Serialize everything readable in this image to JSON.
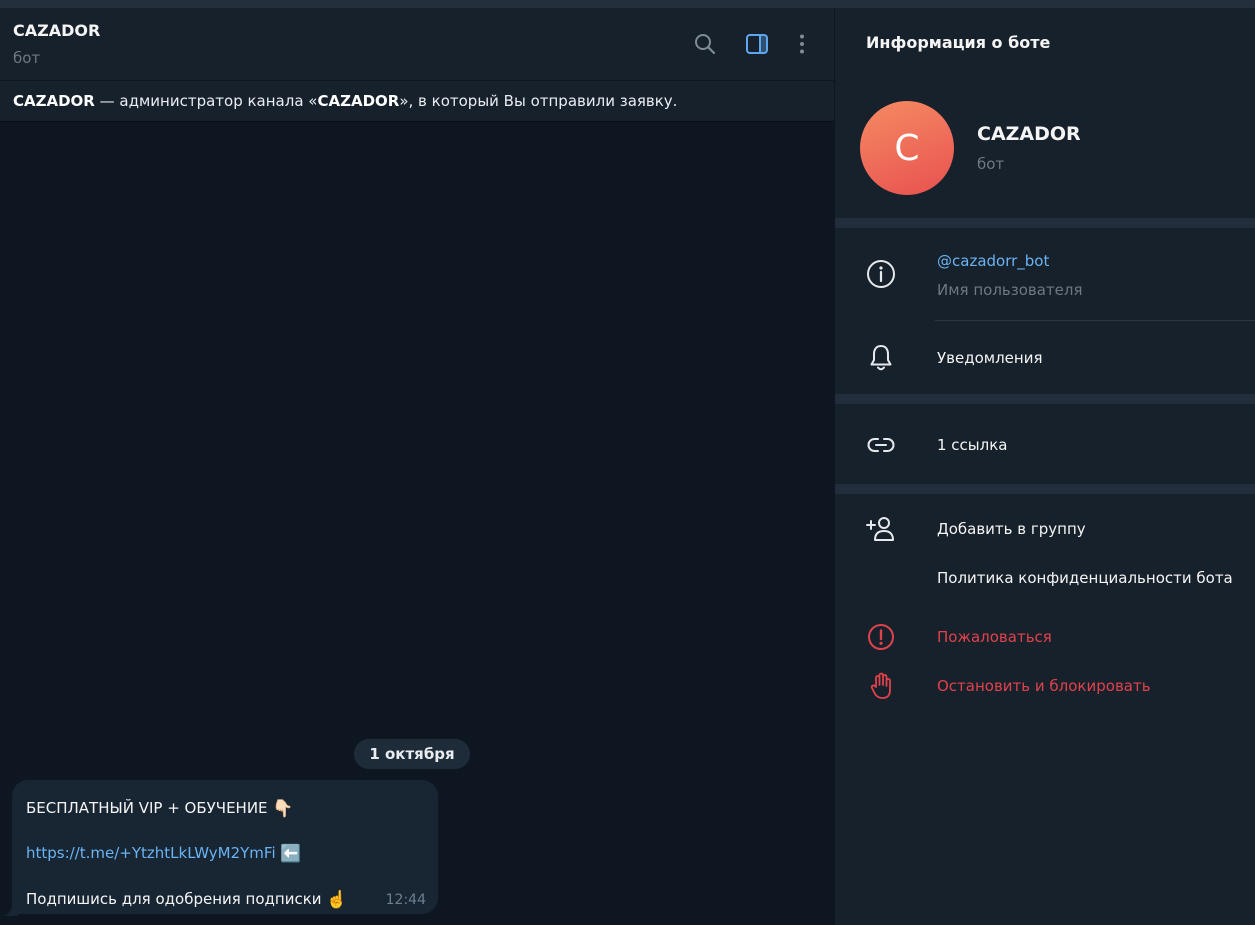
{
  "chat": {
    "title": "CAZADOR",
    "subtitle": "бот",
    "pinned": {
      "name": "CAZADOR",
      "text_before": " — администратор канала «",
      "channel": "CAZADOR",
      "text_after": "», в который Вы отправили заявку."
    },
    "date": "1 октября",
    "message": {
      "line1": "БЕСПЛАТНЫЙ VIP + ОБУЧЕНИЕ",
      "emoji1": "👇🏻",
      "link": "https://t.me/+YtzhtLkLWyM2YmFi",
      "emoji2": "⬅️",
      "line3": "Подпишись для одобрения подписки",
      "emoji3": "☝️",
      "time": "12:44"
    }
  },
  "header_icons": [
    "search-icon",
    "sidebar-toggle-icon",
    "more-vertical-icon"
  ],
  "info": {
    "title": "Информация о боте",
    "avatar_letter": "C",
    "name": "CAZADOR",
    "subtitle": "бот",
    "username": "@cazadorr_bot",
    "username_label": "Имя пользователя",
    "notifications": "Уведомления",
    "links": "1 ссылка",
    "add_to_group": "Добавить в группу",
    "privacy": "Политика конфиденциальности бота",
    "report": "Пожаловаться",
    "block": "Остановить и блокировать"
  },
  "colors": {
    "accent": "#6ab3f3",
    "danger": "#e0424c",
    "chat_bg": "#0e1621",
    "panel_bg": "#17212b"
  }
}
